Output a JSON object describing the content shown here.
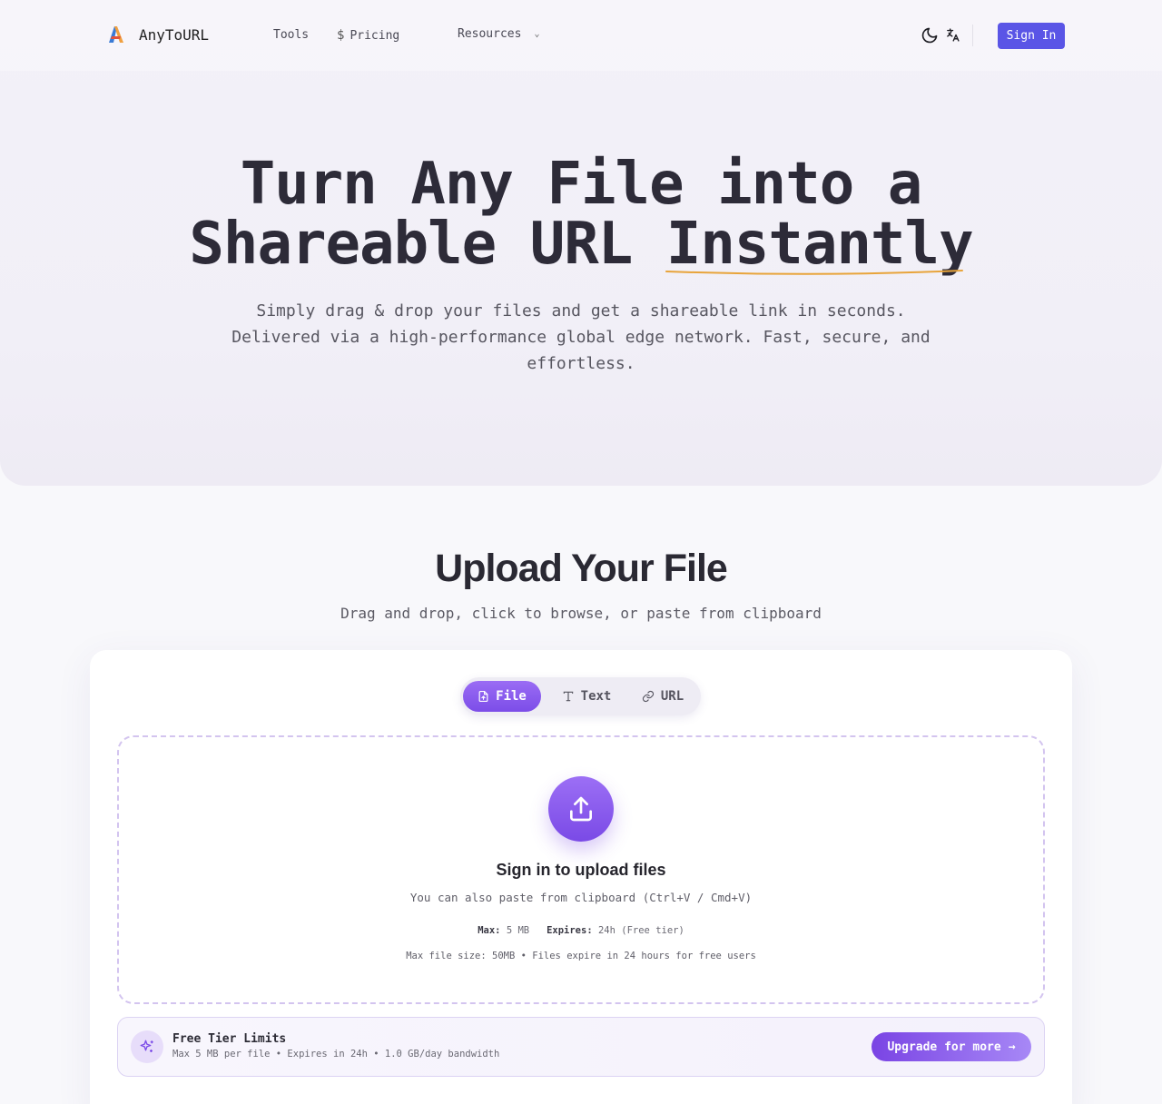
{
  "nav": {
    "brand": "AnyToURL",
    "tools": "Tools",
    "pricing_icon": "$",
    "pricing": "Pricing",
    "resources": "Resources",
    "signin": "Sign In"
  },
  "hero": {
    "title_line1": "Turn Any File into a",
    "title_line2_a": "Shareable URL ",
    "title_line2_b": "Instantly",
    "subtitle": "Simply drag & drop your files and get a shareable link in seconds. Delivered via a high-performance global edge network. Fast, secure, and effortless."
  },
  "upload": {
    "title": "Upload Your File",
    "subtitle": "Drag and drop, click to browse, or paste from clipboard",
    "tabs": [
      {
        "label": "File"
      },
      {
        "label": "Text"
      },
      {
        "label": "URL"
      }
    ],
    "drop_title": "Sign in to upload files",
    "drop_hint": "You can also paste from clipboard (Ctrl+V / Cmd+V)",
    "max_label": "Max:",
    "max_value": "5 MB",
    "expires_label": "Expires:",
    "expires_value": "24h (Free tier)",
    "size_line": "Max file size: 50MB • Files expire in 24 hours for free users"
  },
  "tier": {
    "title": "Free Tier Limits",
    "desc": "Max 5 MB per file • Expires in 24h • 1.0 GB/day bandwidth",
    "upgrade": "Upgrade for more",
    "arrow": "→"
  },
  "colors": {
    "accent": "#7c4de8",
    "signin": "#5a55e6",
    "underline": "#e8a43a"
  }
}
